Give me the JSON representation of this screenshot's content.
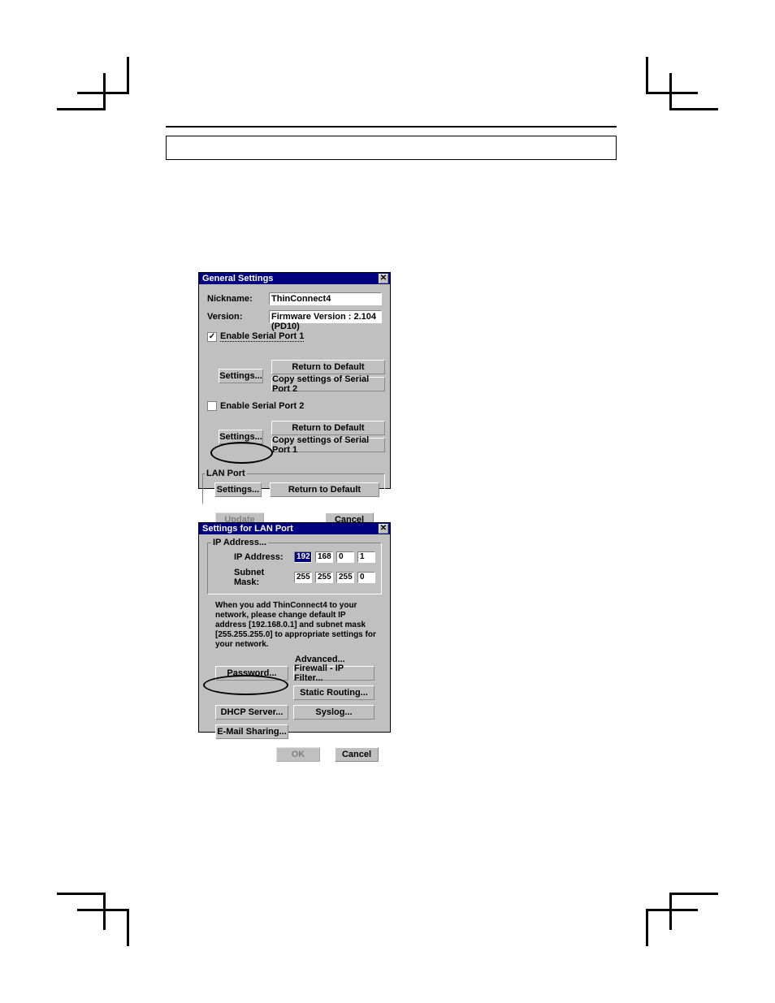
{
  "dialog1": {
    "title": "General Settings",
    "nickname_label": "Nickname:",
    "nickname_value": "ThinConnect4",
    "version_label": "Version:",
    "version_value": "Firmware Version : 2.104  (PD10)",
    "port1": {
      "checkbox_label": "Enable Serial Port 1",
      "checked_mark": "✓",
      "settings": "Settings...",
      "return_default": "Return to Default",
      "copy": "Copy settings of Serial Port 2"
    },
    "port2": {
      "checkbox_label": "Enable Serial Port 2",
      "settings": "Settings...",
      "return_default": "Return to Default",
      "copy": "Copy settings of Serial Port 1"
    },
    "lan": {
      "legend": "LAN Port",
      "settings": "Settings...",
      "return_default": "Return to Default"
    },
    "update": "Update",
    "cancel": "Cancel",
    "close_x": "✕"
  },
  "dialog2": {
    "title": "Settings for LAN Port",
    "ip": {
      "legend": "IP Address...",
      "ip_label": "IP Address:",
      "ip_octets": [
        "192",
        "168",
        "0",
        "1"
      ],
      "mask_label": "Subnet Mask:",
      "mask_octets": [
        "255",
        "255",
        "255",
        "0"
      ]
    },
    "hint": "When you add ThinConnect4 to your network, please change default IP address [192.168.0.1] and subnet mask [255.255.255.0] to appropriate settings for your network.",
    "advanced_label": "Advanced...",
    "buttons": {
      "password": "Password...",
      "firewall": "Firewall - IP Filter...",
      "static_routing": "Static Routing...",
      "dhcp": "DHCP Server...",
      "syslog": "Syslog...",
      "email": "E-Mail Sharing..."
    },
    "ok": "OK",
    "cancel": "Cancel",
    "close_x": "✕"
  }
}
